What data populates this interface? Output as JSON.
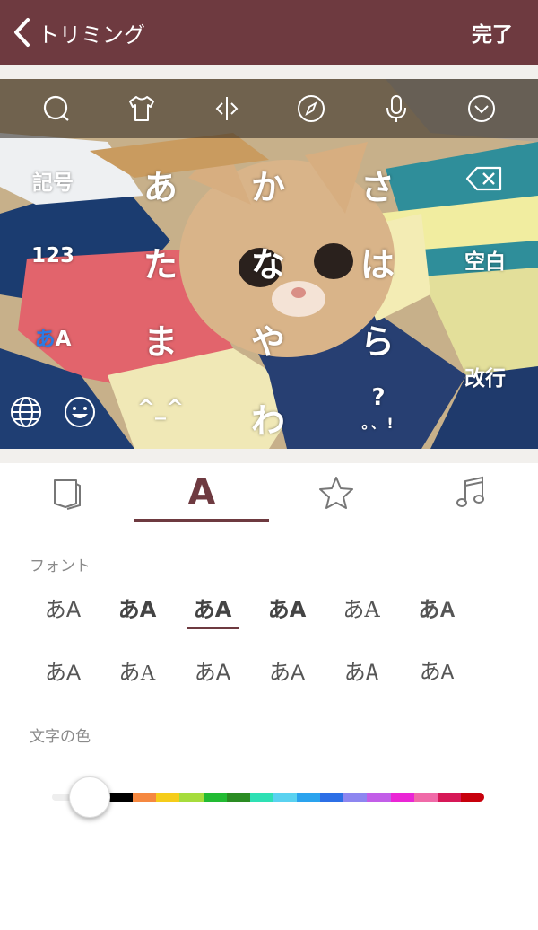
{
  "header": {
    "back_label": "トリミング",
    "done_label": "完了"
  },
  "toolbar": {
    "icons": [
      "search-icon",
      "shirt-icon",
      "resize-icon",
      "compass-icon",
      "mic-icon",
      "chevron-down-icon"
    ]
  },
  "keyboard": {
    "kana": [
      "あ",
      "か",
      "さ",
      "た",
      "な",
      "は",
      "ま",
      "や",
      "ら",
      "わ"
    ],
    "symbols": "記号",
    "numbers": "123",
    "mode_a": "あ",
    "mode_b": "A",
    "space": "空白",
    "enter": "改行",
    "emoticon": "^_^",
    "punct_top": "?",
    "punct_bottom": "。、!"
  },
  "tabs": {
    "font_tab": "A"
  },
  "fonts": {
    "label": "フォント",
    "options": [
      "あA",
      "あA",
      "あA",
      "あA",
      "あA",
      "あA",
      "あA",
      "あA",
      "あA",
      "あA",
      "あA",
      "あA"
    ],
    "selected_index": 2
  },
  "color": {
    "label": "文字の色",
    "swatches": [
      "#000000",
      "#f58840",
      "#f5cc1a",
      "#a6dc3c",
      "#22bb33",
      "#2a8c23",
      "#2ee0b4",
      "#5ad2f0",
      "#2aa3ee",
      "#2c6fe6",
      "#8d86f0",
      "#c25ee8",
      "#ea25d5",
      "#f06aa8",
      "#d61857",
      "#c7000c"
    ],
    "slider_value": 0.0
  }
}
